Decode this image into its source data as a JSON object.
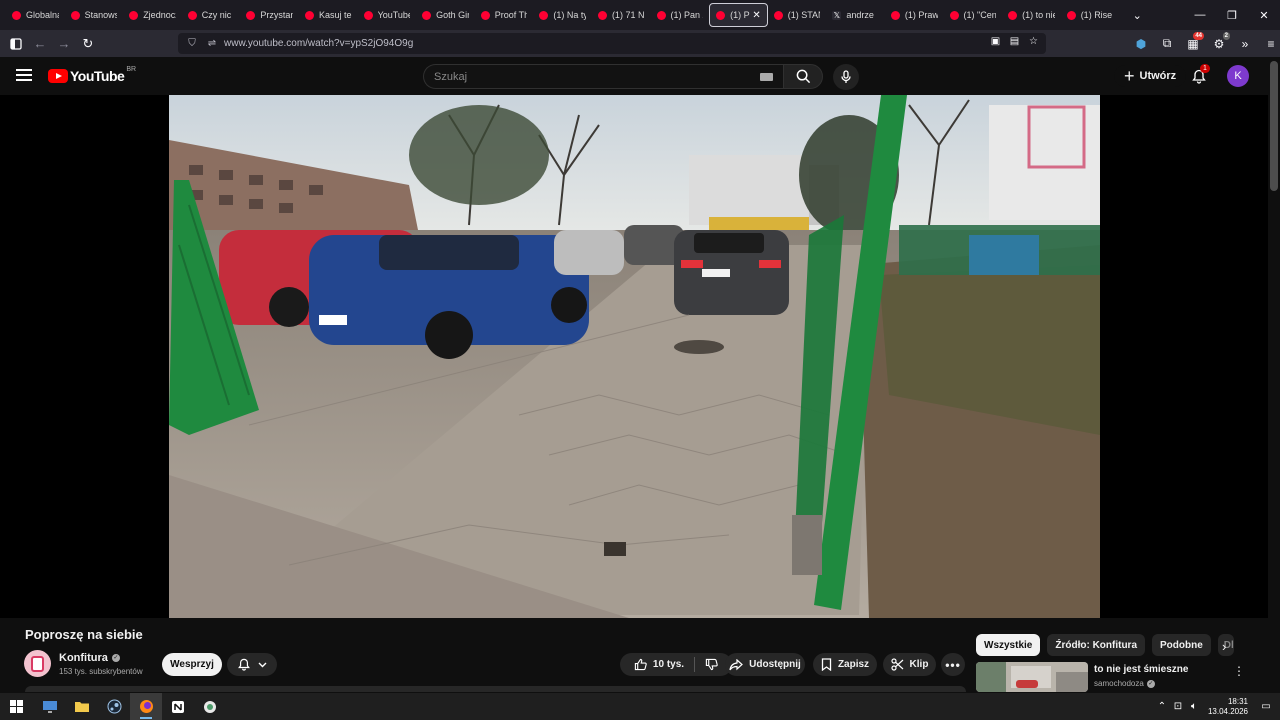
{
  "browser": {
    "tabs": [
      {
        "label": "Globalna",
        "icon": "youtube-icon"
      },
      {
        "label": "Stanows",
        "icon": "youtube-icon"
      },
      {
        "label": "Zjednocz",
        "icon": "youtube-icon"
      },
      {
        "label": "Czy nic n",
        "icon": "youtube-icon"
      },
      {
        "label": "Przystan",
        "icon": "youtube-icon"
      },
      {
        "label": "Kasuj te",
        "icon": "youtube-icon"
      },
      {
        "label": "YouTube",
        "icon": "youtube-icon"
      },
      {
        "label": "Goth Gir",
        "icon": "youtube-icon"
      },
      {
        "label": "Proof Th",
        "icon": "youtube-icon"
      },
      {
        "label": "(1) Na ty",
        "icon": "youtube-icon"
      },
      {
        "label": "(1) 71 N",
        "icon": "youtube-icon"
      },
      {
        "label": "(1) Pan z",
        "icon": "youtube-icon"
      },
      {
        "label": "(1) Po",
        "icon": "youtube-icon",
        "active": true
      },
      {
        "label": "(1) STAN",
        "icon": "youtube-icon"
      },
      {
        "label": "andrze",
        "icon": "x-icon"
      },
      {
        "label": "(1) Praw",
        "icon": "youtube-icon"
      },
      {
        "label": "(1) \"Cen",
        "icon": "youtube-icon"
      },
      {
        "label": "(1) to nie",
        "icon": "youtube-icon"
      },
      {
        "label": "(1) Rise c",
        "icon": "youtube-icon"
      }
    ],
    "url": "www.youtube.com/watch?v=ypS2jO94O9g",
    "extension_badges": {
      "ext1": "44",
      "ext2": "2"
    }
  },
  "youtube": {
    "logo_text": "YouTube",
    "country_code": "BR",
    "search_placeholder": "Szukaj",
    "create_label": "Utwórz",
    "notification_count": "1",
    "avatar_letter": "K"
  },
  "video": {
    "title": "Poproszę na siebie",
    "channel_name": "Konfitura",
    "subscribers": "153 tys. subskrybentów",
    "support_label": "Wesprzyj",
    "likes": "10 tys.",
    "share_label": "Udostępnij",
    "save_label": "Zapisz",
    "clip_label": "Klip"
  },
  "sidebar": {
    "chips": [
      "Wszystkie",
      "Źródło: Konfitura",
      "Podobne",
      "Dla"
    ],
    "recommendation": {
      "title": "to nie jest śmieszne",
      "channel": "samochodoza"
    }
  },
  "taskbar": {
    "time": "18:31",
    "date": "13.04.2026"
  },
  "colors": {
    "youtube_red": "#ff0000",
    "avatar_purple": "#7e3ace",
    "fence_green": "#1f8a3f"
  }
}
